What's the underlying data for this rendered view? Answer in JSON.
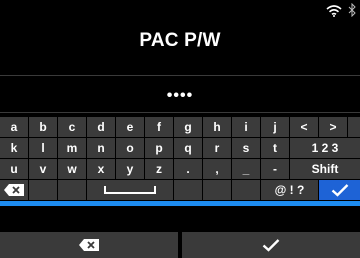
{
  "header": {
    "title": "PAC P/W",
    "wifi_icon": "wifi-icon",
    "bluetooth_icon": "bluetooth-icon"
  },
  "password": {
    "masked_value": "••••"
  },
  "keyboard": {
    "row1": [
      "a",
      "b",
      "c",
      "d",
      "e",
      "f",
      "g",
      "h",
      "i",
      "j",
      "<",
      ">"
    ],
    "row2": [
      "k",
      "l",
      "m",
      "n",
      "o",
      "p",
      "q",
      "r",
      "s",
      "t"
    ],
    "row2_mode": "1 2 3",
    "row3": [
      "u",
      "v",
      "w",
      "x",
      "y",
      "z",
      ".",
      ",",
      "_",
      "-"
    ],
    "row3_shift": "Shift",
    "row4_symbols": "@ ! ?",
    "icons": {
      "backspace": "backspace-icon",
      "space": "space-icon",
      "enter": "check-icon"
    },
    "colors": {
      "key_bg": "#3b3b3b",
      "enter_bg": "#1e63d6",
      "stripe": "#1d8cf0"
    }
  },
  "softkeys": {
    "left_icon": "backspace-icon",
    "right_icon": "check-icon"
  }
}
